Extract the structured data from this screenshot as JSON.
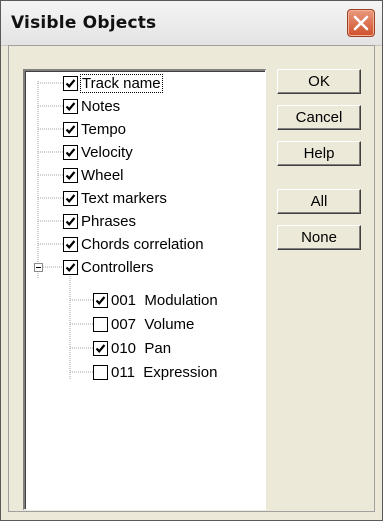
{
  "window": {
    "title": "Visible Objects",
    "close_icon": "close-icon",
    "accent_color": "#d0502b"
  },
  "tree": {
    "items": [
      {
        "label": "Track name",
        "checked": true
      },
      {
        "label": "Notes",
        "checked": true
      },
      {
        "label": "Tempo",
        "checked": true
      },
      {
        "label": "Velocity",
        "checked": true
      },
      {
        "label": "Wheel",
        "checked": true
      },
      {
        "label": "Text markers",
        "checked": true
      },
      {
        "label": "Phrases",
        "checked": true
      },
      {
        "label": "Chords correlation",
        "checked": true
      },
      {
        "label": "Controllers",
        "checked": true,
        "expanded": true
      }
    ],
    "controllers": [
      {
        "label": "001  Modulation",
        "checked": true
      },
      {
        "label": "007  Volume",
        "checked": false
      },
      {
        "label": "010  Pan",
        "checked": true
      },
      {
        "label": "011  Expression",
        "checked": false
      }
    ]
  },
  "buttons": {
    "ok": "OK",
    "cancel": "Cancel",
    "help": "Help",
    "all": "All",
    "none": "None"
  }
}
